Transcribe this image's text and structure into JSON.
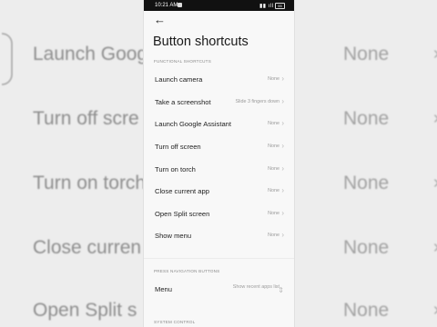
{
  "background": {
    "rows": [
      {
        "label": "Launch Goog",
        "value": "None"
      },
      {
        "label": "Turn off scre",
        "value": "None"
      },
      {
        "label": "Turn on torch",
        "value": "None"
      },
      {
        "label": "Close curren",
        "value": "None"
      },
      {
        "label": "Open Split s",
        "value": "None"
      }
    ]
  },
  "status_bar": {
    "time": "10:21 AM",
    "battery": "55"
  },
  "header": {
    "back_icon": "back-arrow-icon",
    "title": "Button shortcuts"
  },
  "sections": [
    {
      "header": "FUNCTIONAL SHORTCUTS",
      "items": [
        {
          "label": "Launch camera",
          "value": "None"
        },
        {
          "label": "Take a screenshot",
          "value": "Slide 3 fingers down"
        },
        {
          "label": "Launch Google Assistant",
          "value": "None"
        },
        {
          "label": "Turn off screen",
          "value": "None"
        },
        {
          "label": "Turn on torch",
          "value": "None"
        },
        {
          "label": "Close current app",
          "value": "None"
        },
        {
          "label": "Open Split screen",
          "value": "None"
        },
        {
          "label": "Show menu",
          "value": "None"
        }
      ]
    },
    {
      "header": "PRESS NAVIGATION BUTTONS",
      "items": [
        {
          "label": "Menu",
          "value": "Show recent apps list"
        }
      ]
    },
    {
      "header": "SYSTEM CONTROL",
      "items": []
    }
  ]
}
